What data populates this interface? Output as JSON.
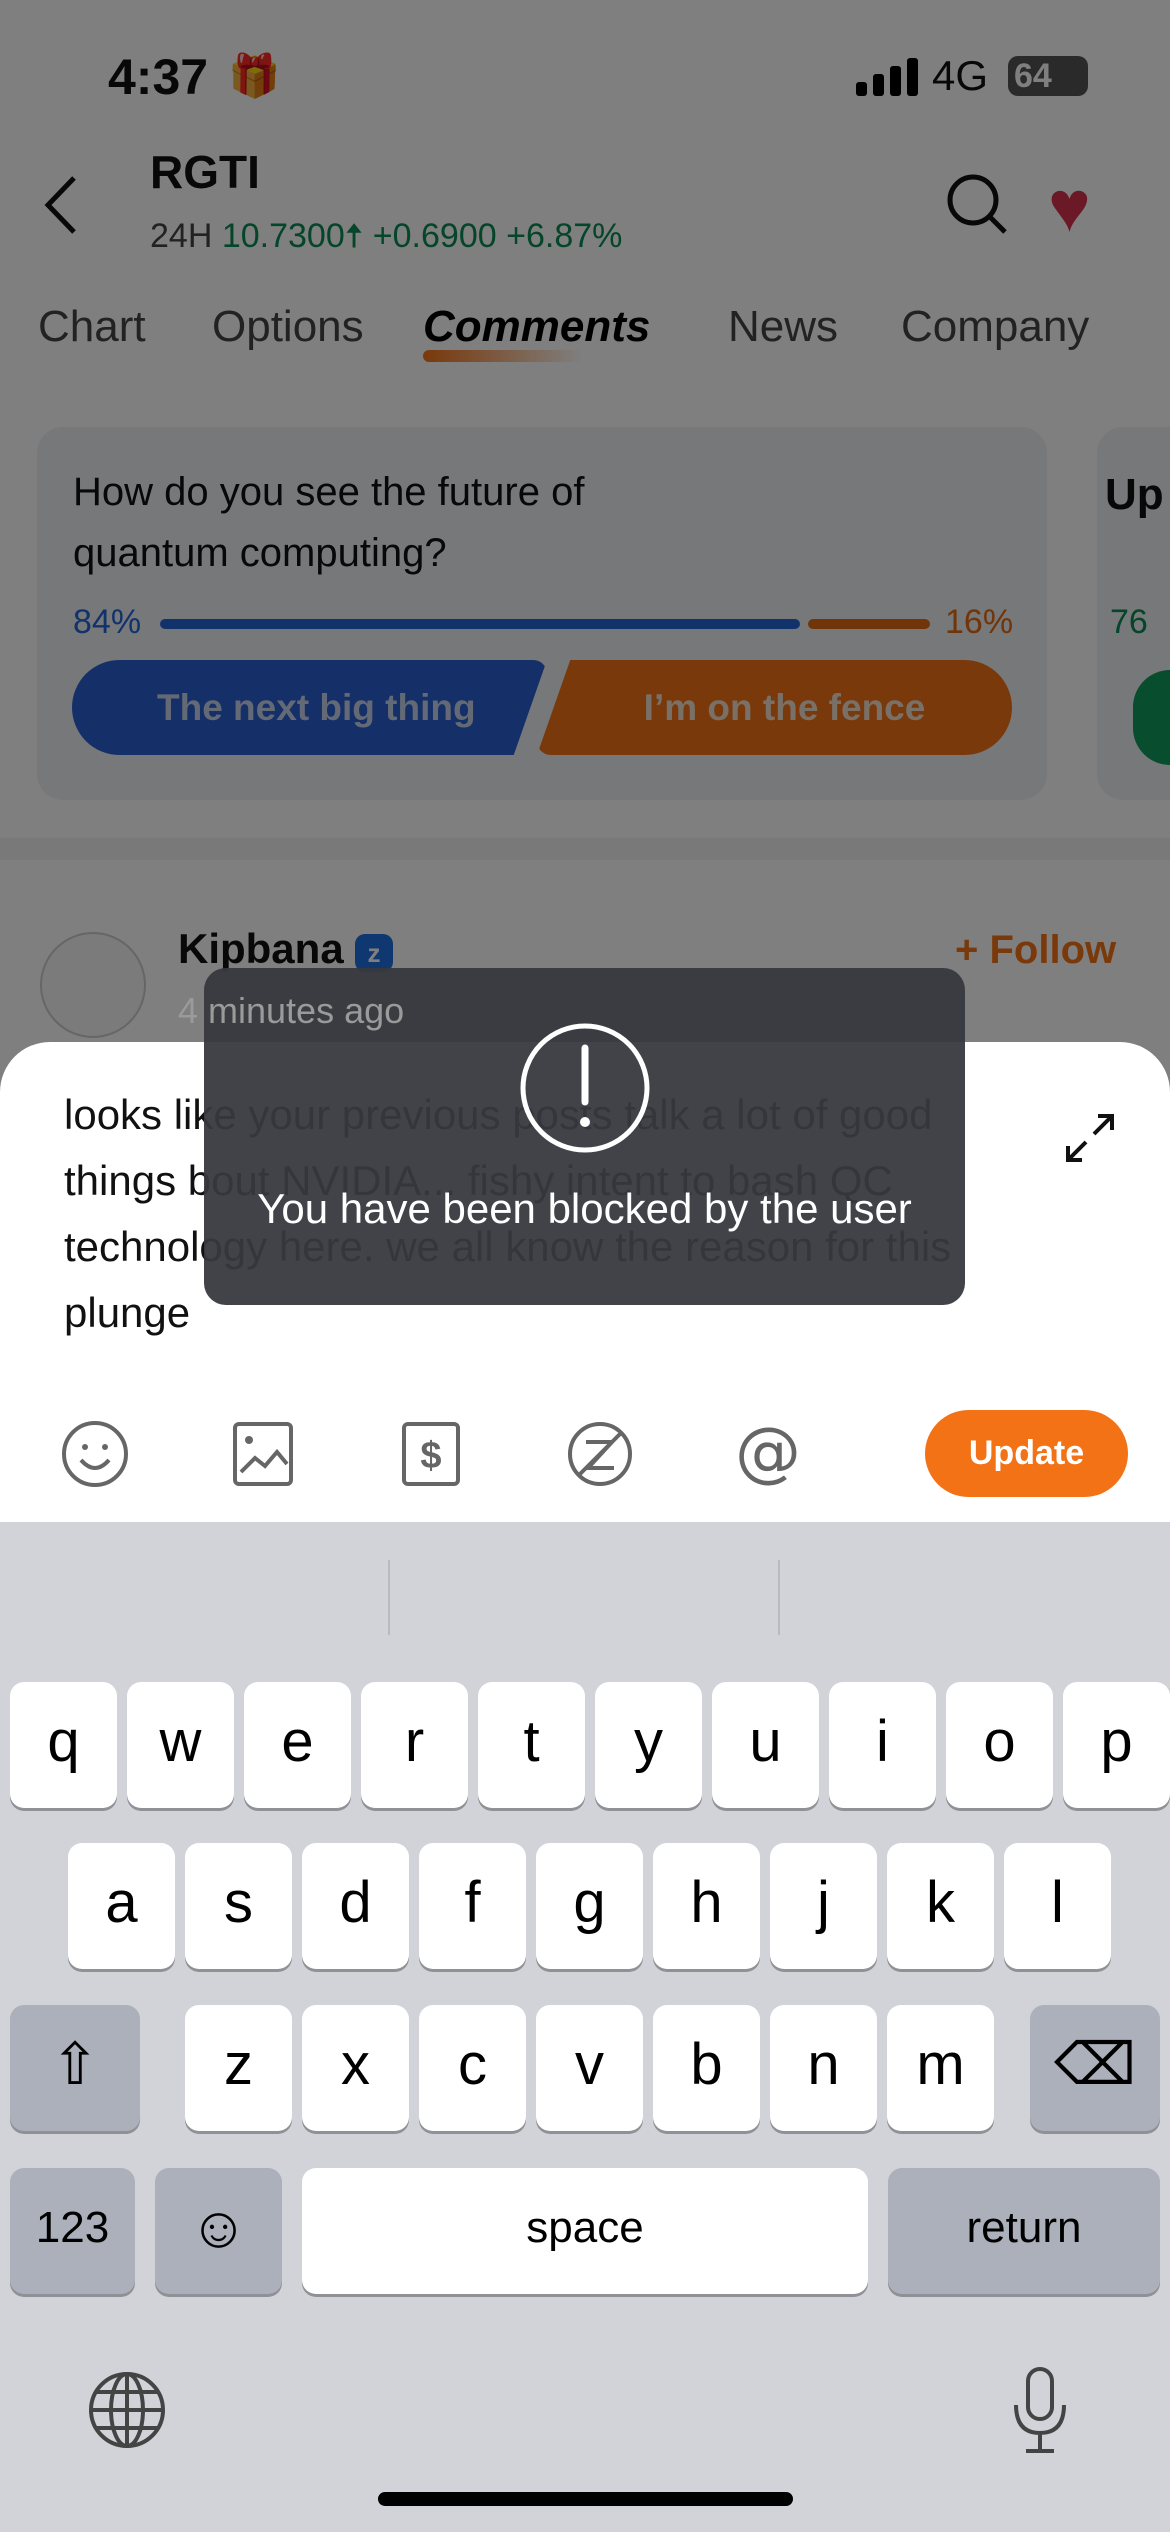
{
  "status": {
    "time": "4:37",
    "network": "4G",
    "battery": "64"
  },
  "header": {
    "symbol": "RGTI",
    "period": "24H",
    "price": "10.7300",
    "arrow": "🠅",
    "change": "+0.6900",
    "change_pct": "+6.87%"
  },
  "tabs": [
    {
      "label": "Chart"
    },
    {
      "label": "Options"
    },
    {
      "label": "Comments",
      "active": true
    },
    {
      "label": "News"
    },
    {
      "label": "Company"
    }
  ],
  "poll": {
    "question": "How do you see the future of quantum computing?",
    "yes_pct": "84%",
    "no_pct": "16%",
    "yes_fraction": 0.84,
    "yes_label": "The next big thing",
    "no_label": "I’m on the fence"
  },
  "poll2": {
    "title_partial": "Up",
    "pct_partial": "76"
  },
  "comment": {
    "user": "Kipbana",
    "time": "4 minutes ago",
    "follow": "+ Follow"
  },
  "editor": {
    "text": "looks like your previous posts talk a lot of good things bout NVIDIA... fishy intent to bash QC technology here. we all know the reason for this plunge",
    "update": "Update"
  },
  "toast": {
    "message": "You have been blocked by the user"
  },
  "keyboard": {
    "row1": [
      "q",
      "w",
      "e",
      "r",
      "t",
      "y",
      "u",
      "i",
      "o",
      "p"
    ],
    "row2": [
      "a",
      "s",
      "d",
      "f",
      "g",
      "h",
      "j",
      "k",
      "l"
    ],
    "row3": [
      "z",
      "x",
      "c",
      "v",
      "b",
      "n",
      "m"
    ],
    "numbers": "123",
    "space": "space",
    "return": "return"
  },
  "colors": {
    "accent": "#f47216",
    "up": "#0a8a55",
    "yes": "#2565d9",
    "toast": "#3c3e44"
  }
}
